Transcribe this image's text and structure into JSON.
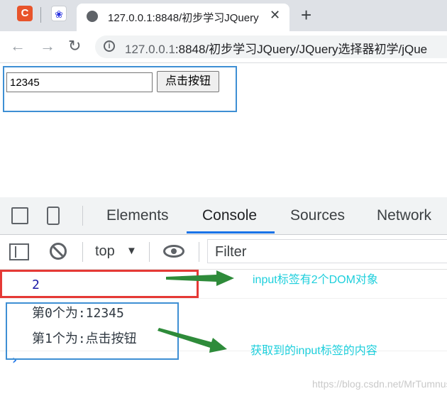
{
  "browser": {
    "pinned_tab_1_letter": "C",
    "pinned_tab_2_icon": "baidu-paw-icon",
    "active_tab_title": "127.0.0.1:8848/初步学习JQuery",
    "close_glyph": "✕",
    "new_tab_glyph": "+",
    "url_host": "127.0.0.1",
    "url_rest": ":8848/初步学习JQuery/JQuery选择器初学/jQue",
    "nav_icons": [
      "back-arrow-icon",
      "forward-arrow-icon",
      "reload-icon",
      "info-icon"
    ]
  },
  "page": {
    "input_value": "12345",
    "button_label": "点击按钮"
  },
  "devtools": {
    "tabs": [
      "Elements",
      "Console",
      "Sources",
      "Network"
    ],
    "active_tab": "Console",
    "context": "top",
    "context_caret": "▼",
    "filter_placeholder": "Filter",
    "icons": [
      "inspect-element-icon",
      "device-toolbar-icon",
      "sidebar-toggle-icon",
      "clear-console-icon",
      "eye-icon"
    ]
  },
  "console": {
    "line1": "2",
    "line2": "第0个为:12345",
    "line3": "第1个为:点击按钮",
    "prompt": "›"
  },
  "annotations": {
    "top": "input标签有2个DOM对象",
    "bottom": "获取到的input标签的内容",
    "color": "#1ecfdc",
    "arrow_color": "#2e8b3a",
    "red_box_color": "#e53935",
    "blue_box_color": "#3e8fd4"
  },
  "watermark": "https://blog.csdn.net/MrTumnus"
}
